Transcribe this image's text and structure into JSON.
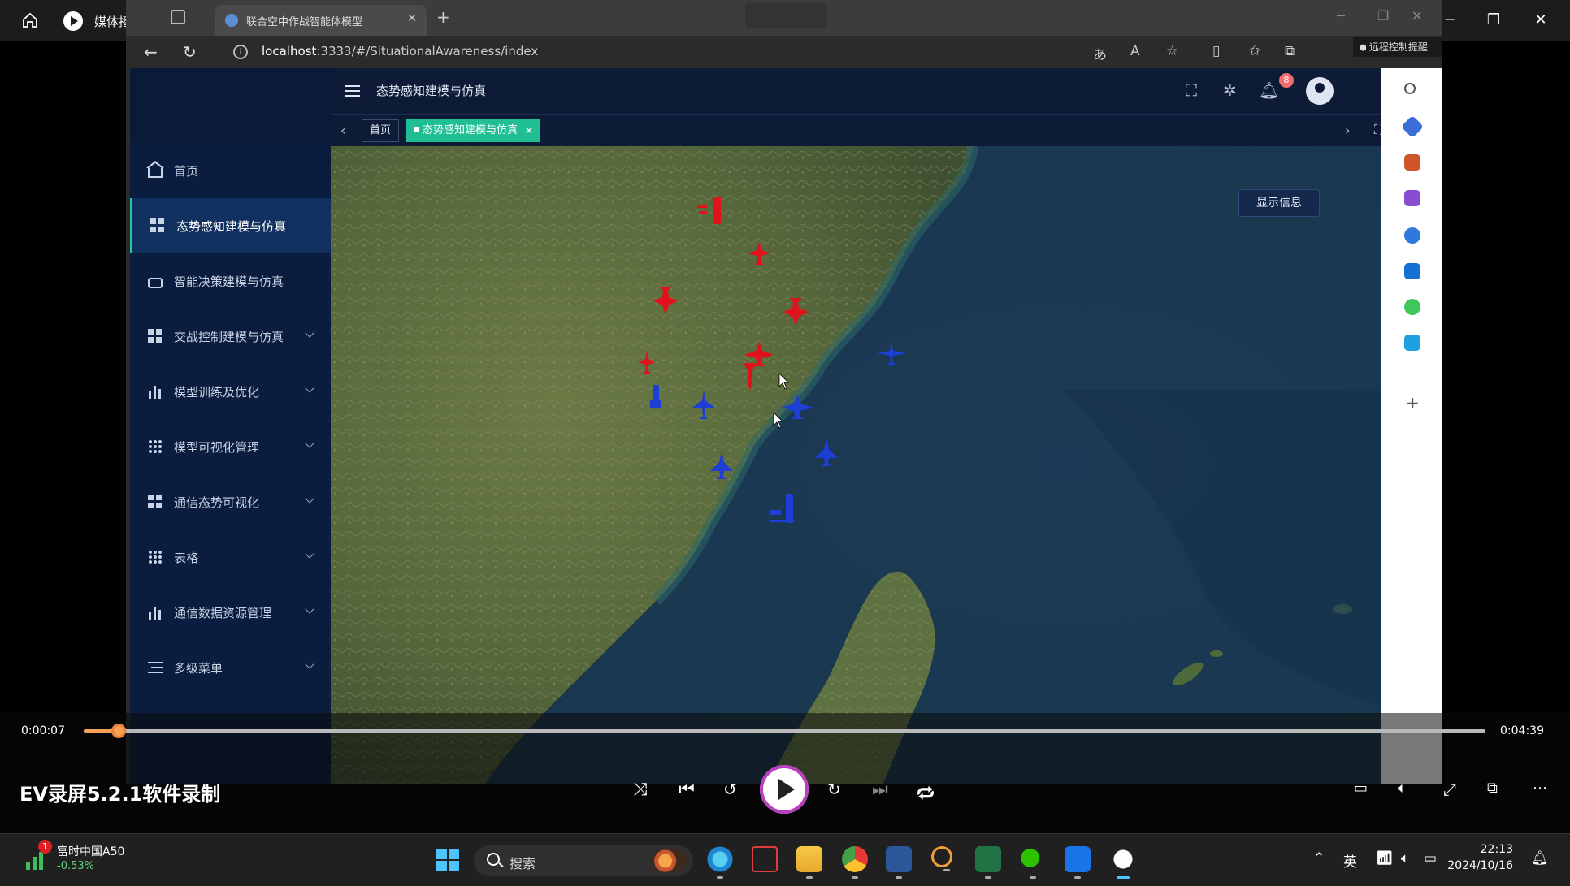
{
  "player": {
    "app_title": "媒体播放器",
    "current_time": "0:00:07",
    "total_time": "0:04:39",
    "progress": 0.025,
    "watermark": "EV录屏5.2.1软件录制",
    "accent_color": "#f7a056",
    "icons": [
      "home-icon",
      "shuffle-icon",
      "previous-icon",
      "rewind-10-icon",
      "play-icon",
      "forward-30-icon",
      "next-icon",
      "repeat-icon",
      "subtitles-icon",
      "volume-icon",
      "fullscreen-icon",
      "miniplayer-icon",
      "more-icon"
    ]
  },
  "browser": {
    "tab_title": "联合空中作战智能体模型",
    "url_host": "localhost",
    "url_rest": ":3333/#/SituationalAwareness/index",
    "remote_badge": "远程控制提醒"
  },
  "app": {
    "header_title": "态势感知建模与仿真",
    "notification_count": "8",
    "tags": {
      "home": "首页",
      "active": "态势感知建模与仿真"
    },
    "menu": [
      {
        "label": "首页",
        "icon": "house-icon",
        "active": false,
        "expandable": false
      },
      {
        "label": "态势感知建模与仿真",
        "icon": "grid-icon",
        "active": true,
        "expandable": false
      },
      {
        "label": "智能决策建模与仿真",
        "icon": "bag-icon",
        "active": false,
        "expandable": false
      },
      {
        "label": "交战控制建模与仿真",
        "icon": "grid-icon",
        "active": false,
        "expandable": true
      },
      {
        "label": "模型训练及优化",
        "icon": "bar-chart-icon",
        "active": false,
        "expandable": true
      },
      {
        "label": "模型可视化管理",
        "icon": "small-grid-icon",
        "active": false,
        "expandable": true
      },
      {
        "label": "通信态势可视化",
        "icon": "grid-icon",
        "active": false,
        "expandable": true
      },
      {
        "label": "表格",
        "icon": "small-grid-icon",
        "active": false,
        "expandable": true
      },
      {
        "label": "通信数据资源管理",
        "icon": "bar-chart-icon",
        "active": false,
        "expandable": true
      },
      {
        "label": "多级菜单",
        "icon": "list-icon",
        "active": false,
        "expandable": true
      }
    ],
    "map": {
      "show_info_label": "显示信息",
      "red_color": "#e0121b",
      "blue_color": "#1e3fd6"
    }
  },
  "taskbar": {
    "stock_name": "富时中国A50",
    "stock_change": "-0.53%",
    "stock_badge": "1",
    "search_placeholder": "搜索",
    "ime": "英",
    "time": "22:13",
    "date": "2024/10/16"
  }
}
